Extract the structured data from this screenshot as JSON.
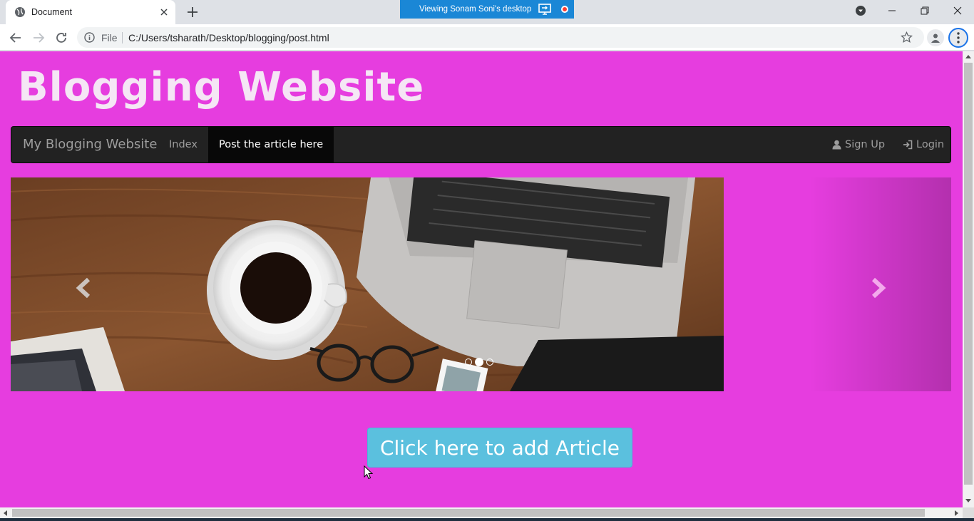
{
  "browser": {
    "tab_title": "Document",
    "share_banner": "Viewing Sonam Soni's desktop",
    "file_label": "File",
    "url": "C:/Users/tsharath/Desktop/blogging/post.html"
  },
  "site": {
    "title": "Blogging Website",
    "brand": "My Blogging Website",
    "nav": {
      "index": "Index",
      "post": "Post the article here",
      "signup": "Sign Up",
      "login": "Login"
    },
    "carousel": {
      "slide_count": 3,
      "active_slide": 2
    },
    "add_button": "Click here to add Article"
  },
  "colors": {
    "page_bg": "#e63ddf",
    "navbar_bg": "#222222",
    "button_bg": "#5bc0de"
  }
}
